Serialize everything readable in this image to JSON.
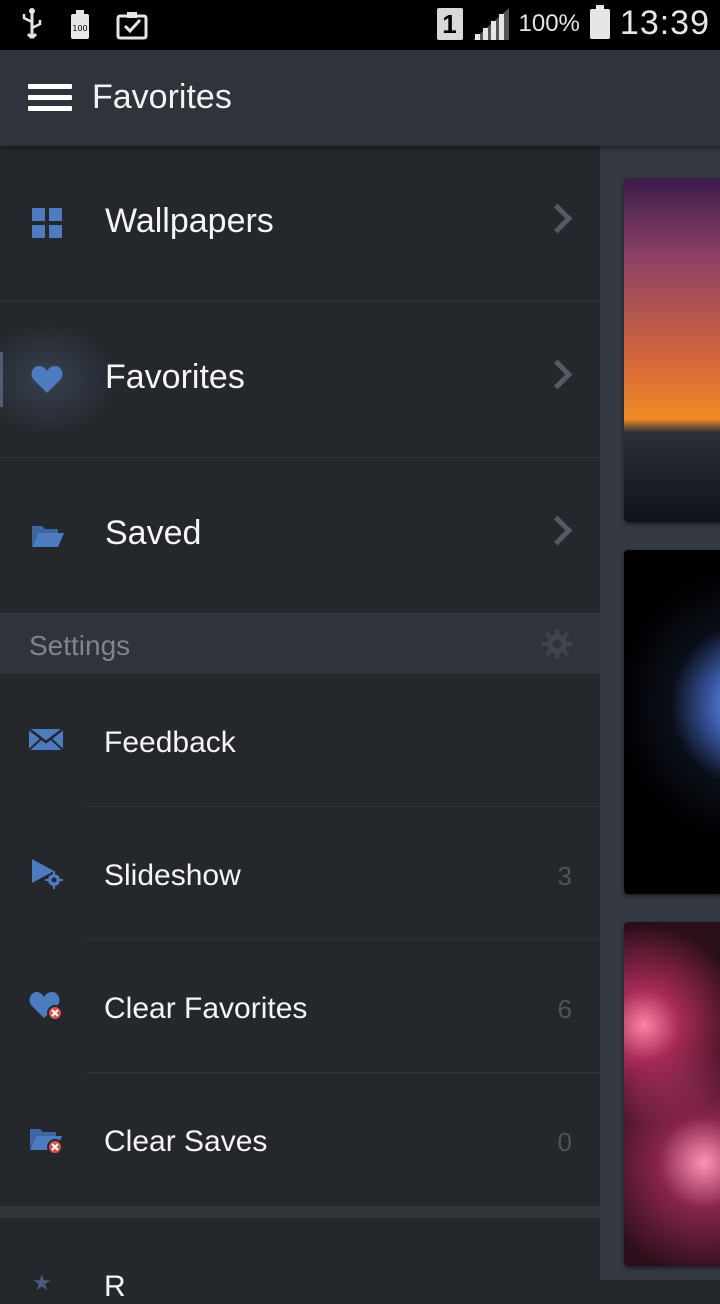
{
  "status_bar": {
    "left_icons": [
      "usb-icon",
      "battery-100-icon",
      "clipboard-check-icon"
    ],
    "sim": "1",
    "battery_percent": "100%",
    "time": "13:39"
  },
  "app_bar": {
    "title": "Favorites"
  },
  "drawer": {
    "nav_items": [
      {
        "label": "Wallpapers",
        "icon": "grid-icon"
      },
      {
        "label": "Favorites",
        "icon": "heart-icon"
      },
      {
        "label": "Saved",
        "icon": "folder-open-icon"
      }
    ],
    "settings_header": "Settings",
    "settings_items": [
      {
        "label": "Feedback",
        "icon": "envelope-icon",
        "count": ""
      },
      {
        "label": "Slideshow",
        "icon": "slideshow-gear-icon",
        "count": "3"
      },
      {
        "label": "Clear Favorites",
        "icon": "heart-remove-icon",
        "count": "6"
      },
      {
        "label": "Clear Saves",
        "icon": "folder-remove-icon",
        "count": "0"
      }
    ],
    "bottom_peek_label": "R"
  },
  "colors": {
    "accent_icon": "#4c7bc0",
    "drawer_bg": "#24272c",
    "app_bar_bg": "#2f333b",
    "remove_badge": "#d9534f"
  }
}
